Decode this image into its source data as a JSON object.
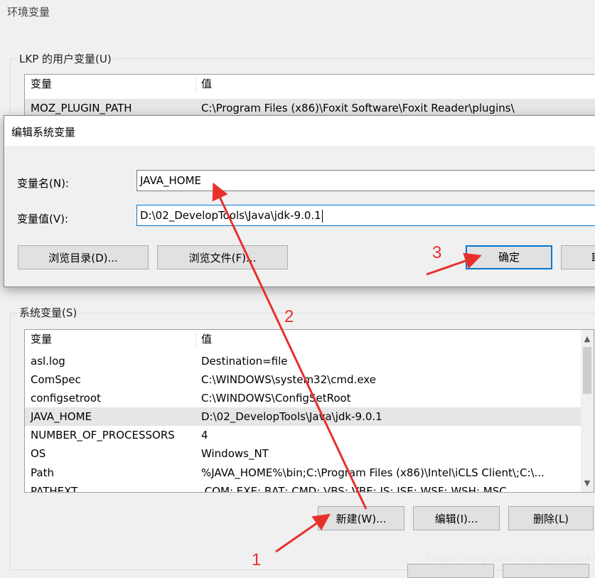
{
  "window": {
    "title": "环境变量"
  },
  "user_vars": {
    "group_label": "LKP 的用户变量(U)",
    "headers": {
      "name": "变量",
      "value": "值"
    },
    "rows": [
      {
        "name": "MOZ_PLUGIN_PATH",
        "value": "C:\\Program Files (x86)\\Foxit Software\\Foxit Reader\\plugins\\"
      }
    ]
  },
  "dialog": {
    "title": "编辑系统变量",
    "name_label": "变量名(N):",
    "name_value": "JAVA_HOME",
    "value_label": "变量值(V):",
    "value_value": "D:\\02_DevelopTools\\Java\\jdk-9.0.1",
    "browse_dir": "浏览目录(D)...",
    "browse_file": "浏览文件(F)...",
    "ok": "确定",
    "cancel": "取"
  },
  "system_vars": {
    "group_label": "系统变量(S)",
    "headers": {
      "name": "变量",
      "value": "值"
    },
    "rows": [
      {
        "name": "asl.log",
        "value": "Destination=file"
      },
      {
        "name": "ComSpec",
        "value": "C:\\WINDOWS\\system32\\cmd.exe"
      },
      {
        "name": "configsetroot",
        "value": "C:\\WINDOWS\\ConfigSetRoot"
      },
      {
        "name": "JAVA_HOME",
        "value": "D:\\02_DevelopTools\\Java\\jdk-9.0.1"
      },
      {
        "name": "NUMBER_OF_PROCESSORS",
        "value": "4"
      },
      {
        "name": "OS",
        "value": "Windows_NT"
      },
      {
        "name": "Path",
        "value": "%JAVA_HOME%\\bin;C:\\Program Files (x86)\\Intel\\iCLS Client\\;C:\\..."
      },
      {
        "name": "PATHEXT",
        "value": ".COM;.EXE;.BAT;.CMD;.VBS;.VBE;.JS;.JSE;.WSF;.WSH;.MSC"
      }
    ],
    "selected_index": 3,
    "buttons": {
      "new": "新建(W)...",
      "edit": "编辑(I)...",
      "delete": "删除(L)"
    }
  },
  "annotations": {
    "step1": "1",
    "step2": "2",
    "step3": "3",
    "color": "#e8302b"
  },
  "watermark": "https://blog.csdn.net/qljazzqljazz",
  "colors": {
    "accent": "#0078d7",
    "annotation": "#e8302b"
  }
}
